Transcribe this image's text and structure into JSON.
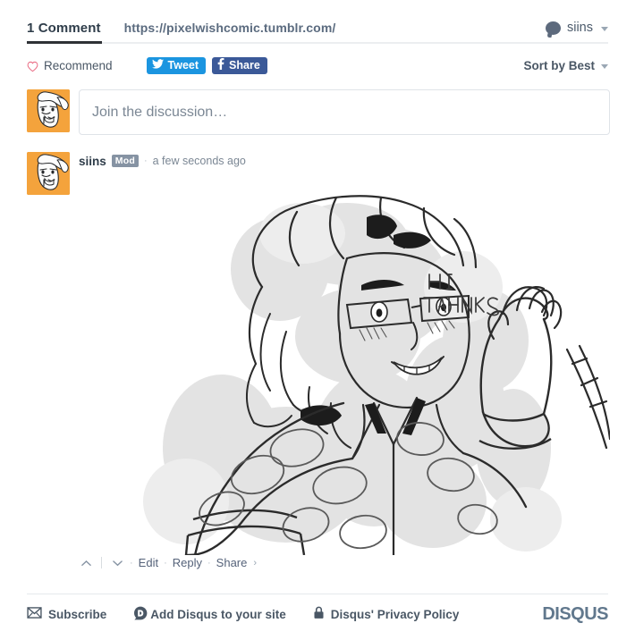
{
  "header": {
    "comment_count_label": "1 Comment",
    "thread_url": "https://pixelwishcomic.tumblr.com/",
    "user": {
      "name": "siins",
      "avatar_icon": "speech-bubble-avatar-icon",
      "dropdown_icon": "chevron-down-icon"
    }
  },
  "toolbar": {
    "recommend_label": "Recommend",
    "recommend_icon": "heart-icon",
    "tweet_label": "Tweet",
    "tweet_icon": "twitter-bird-icon",
    "tweet_color": "#1b95e0",
    "share_label": "Share",
    "share_icon": "facebook-f-icon",
    "share_color": "#3b5998",
    "sort_label": "Sort by Best",
    "sort_icon": "chevron-down-icon"
  },
  "composer": {
    "placeholder": "Join the discussion…",
    "avatar_icon": "user-avatar-cartoon",
    "avatar_bg": "#f4a33c"
  },
  "comment": {
    "author": "siins",
    "badge": "Mod",
    "separator": "·",
    "timestamp": "a few seconds ago",
    "avatar_icon": "user-avatar-cartoon",
    "media": {
      "type": "sketch-drawing",
      "description": "Pencil sketch of a person with glasses waving",
      "handwritten_text_line1": "HI",
      "handwritten_text_line2": "THANKS"
    },
    "actions": {
      "upvote_icon": "chevron-up-icon",
      "downvote_icon": "chevron-down-icon",
      "edit_label": "Edit",
      "reply_label": "Reply",
      "share_label": "Share",
      "share_chevron": "›",
      "dot": "·"
    }
  },
  "footer": {
    "items": [
      {
        "label": "Subscribe",
        "icon": "envelope-icon"
      },
      {
        "label": "Add Disqus to your site",
        "icon": "disqus-d-icon"
      },
      {
        "label": "Disqus' Privacy Policy",
        "icon": "padlock-icon"
      }
    ],
    "logo": "DISQUS",
    "logo_color": "#61788d"
  }
}
